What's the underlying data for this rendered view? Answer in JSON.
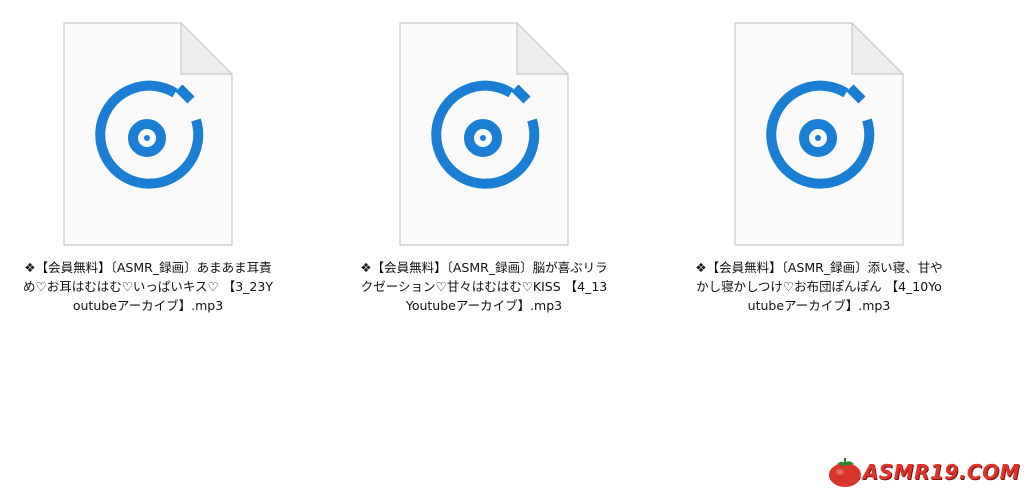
{
  "files": [
    {
      "name": "❖【会員無料】〔ASMR_録画〕あまあま耳責め♡お耳はむはむ♡いっぱいキス♡ 【3_23Youtubeアーカイブ】.mp3"
    },
    {
      "name": "❖【会員無料】〔ASMR_録画〕脳が喜ぶリラクゼーション♡甘々はむはむ♡KISS 【4_13Youtubeアーカイブ】.mp3"
    },
    {
      "name": "❖【会員無料】〔ASMR_録画〕添い寝、甘やかし寝かしつけ♡お布団ぽんぽん 【4_10Youtubeアーカイブ】.mp3"
    }
  ],
  "watermark": {
    "text": "ASMR19.COM"
  },
  "icon": {
    "name": "groove-music-file-icon",
    "color": "#1a7fd4"
  }
}
